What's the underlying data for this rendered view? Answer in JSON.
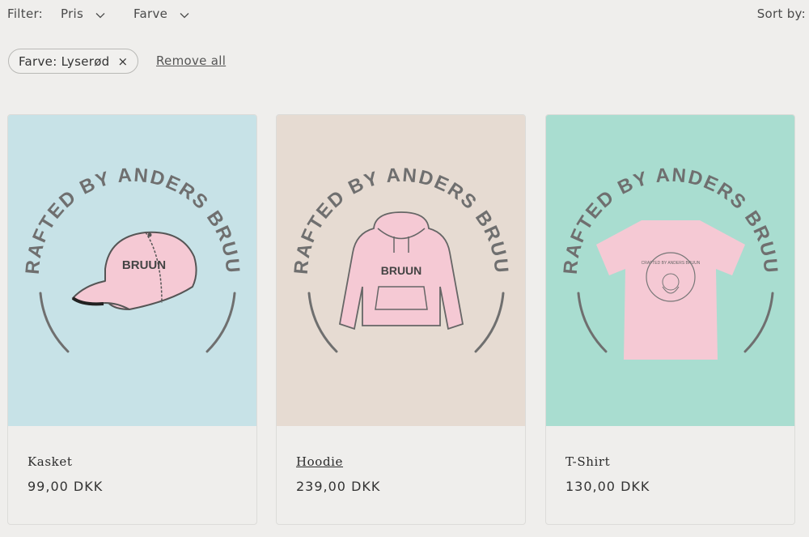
{
  "filters": {
    "label": "Filter:",
    "price_label": "Pris",
    "color_label": "Farve",
    "sort_label": "Sort by:"
  },
  "active_filter": {
    "label": "Farve: Lyserød",
    "remove_glyph": "×",
    "remove_all_label": "Remove all"
  },
  "products": [
    {
      "name": "Kasket",
      "price": "99,00 DKK",
      "bg": "#c7e2e7",
      "logo_text": "CRAFTED BY ANDERS BRUUN",
      "print_text": "BRUUN",
      "icon": "cap-icon"
    },
    {
      "name": "Hoodie",
      "price": "239,00 DKK",
      "bg": "#e6dbd2",
      "logo_text": "CRAFTED BY ANDERS BRUUN",
      "print_text": "BRUUN",
      "icon": "hoodie-icon"
    },
    {
      "name": "T-Shirt",
      "price": "130,00 DKK",
      "bg": "#a9ddd0",
      "logo_text": "CRAFTED BY ANDERS BRUUN",
      "print_text": "CRAFTED BY ANDERS BRUUN",
      "icon": "tshirt-icon"
    }
  ],
  "colors": {
    "garment_pink": "#f5c9d4",
    "logo_gray": "#6f6f6f"
  }
}
